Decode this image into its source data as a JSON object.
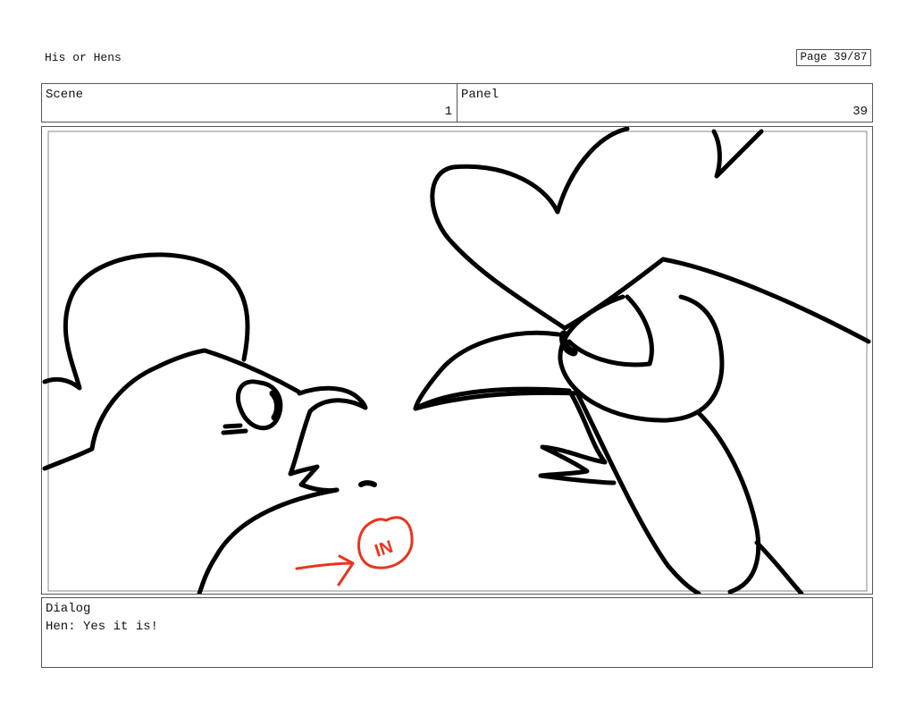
{
  "document": {
    "title": "His or Hens",
    "page_counter": "Page 39/87"
  },
  "scene": {
    "label": "Scene",
    "value": "1"
  },
  "panel": {
    "label": "Panel",
    "value": "39"
  },
  "drawing": {
    "annotation_text": "IN",
    "annotation_color": "#e8351c",
    "line_color": "#000000"
  },
  "dialog": {
    "label": "Dialog",
    "text": "Hen: Yes it is!"
  }
}
